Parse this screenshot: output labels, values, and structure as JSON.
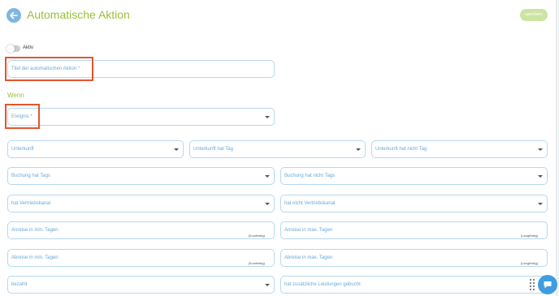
{
  "header": {
    "title": "Automatische Aktion",
    "save_label": "speichern"
  },
  "toggle": {
    "label": "Aktiv",
    "state": "off"
  },
  "title_field": {
    "label": "Titel der automatischen Aktion *"
  },
  "section": {
    "heading": "Wenn"
  },
  "event_field": {
    "label": "Ereignis *"
  },
  "row1": {
    "unterkunft": "Unterkunft",
    "unterkunft_hat_tag": "Unterkunft hat Tag",
    "unterkunft_hat_nicht_tag": "Unterkunft hat nicht Tag"
  },
  "row2": {
    "buchung_hat_tags": "Buchung hat Tags",
    "buchung_hat_nicht_tags": "Buchung hat nicht Tags"
  },
  "row3": {
    "hat_vertriebskanal": "hat Vertriebskanal",
    "hat_nicht_vertriebskanal": "hat nicht Vertriebskanal"
  },
  "row4": {
    "anreise_min": "Anreise in min. Tagen",
    "anreise_min_hint": "(Kurzfristig)",
    "anreise_max": "Anreise in max. Tagen",
    "anreise_max_hint": "(Langfristig)"
  },
  "row5": {
    "abreise_min": "Abreise in min. Tagen",
    "abreise_min_hint": "(Kurzfristig)",
    "abreise_max": "Abreise in max. Tagen",
    "abreise_max_hint": "(Langfristig)"
  },
  "row6": {
    "bezahlt": "bezahlt",
    "zusaetzliche_leistungen": "hat zusätzliche Leistungen gebucht"
  },
  "colors": {
    "accent_green": "#9bbf3a",
    "field_border": "#b5d8ee",
    "label_blue": "#6aa9d8",
    "highlight_orange": "#e4552b",
    "chat_blue": "#3f9de0"
  }
}
